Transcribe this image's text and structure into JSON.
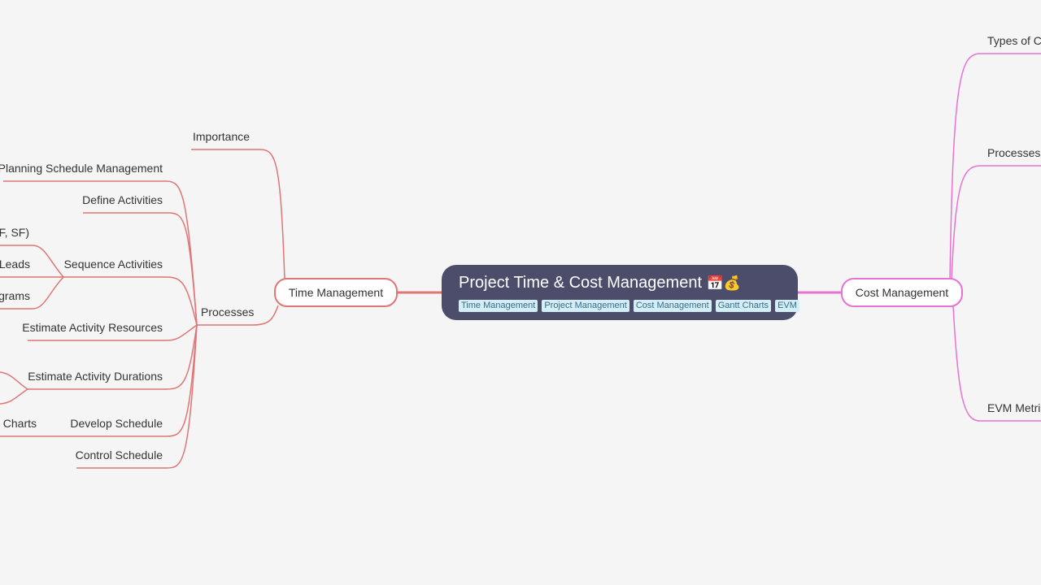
{
  "root": {
    "title": "Project Time & Cost Management",
    "emoji_calendar": "📅",
    "emoji_money": "💰",
    "tags": [
      "Time Management",
      "Project Management",
      "Cost Management",
      "Gantt Charts",
      "EVM"
    ]
  },
  "colors": {
    "time_branch": "#e07575",
    "cost_branch": "#e872d4",
    "root_bg": "#4b4d6b",
    "tag_bg": "#d3eef7"
  },
  "time_management": {
    "label": "Time Management",
    "importance": "Importance",
    "processes": {
      "label": "Processes",
      "items": [
        "Planning Schedule Management",
        "Define Activities",
        "Sequence Activities",
        "Estimate Activity Resources",
        "Estimate Activity Durations",
        "Develop Schedule",
        "Control Schedule"
      ],
      "sequence_children_partial": [
        "FF, SF)",
        "Leads",
        "grams"
      ],
      "develop_children_partial": [
        "t Charts"
      ]
    }
  },
  "cost_management": {
    "label": "Cost Management",
    "children_partial": [
      "Types of Co",
      "Processes",
      "EVM Metric"
    ]
  }
}
